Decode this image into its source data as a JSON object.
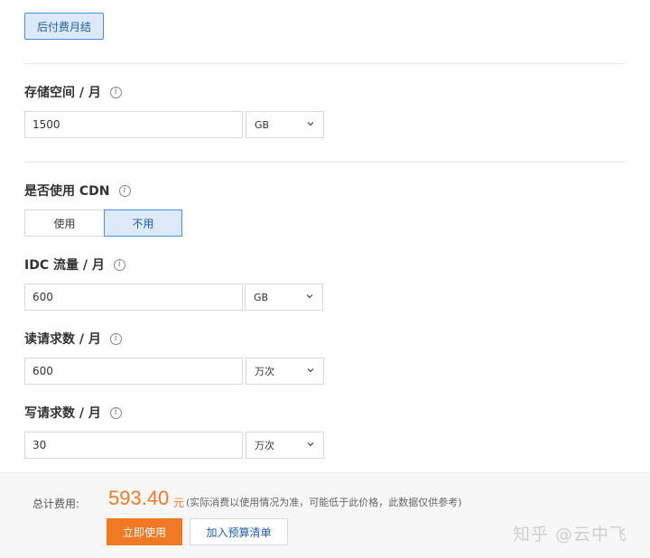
{
  "billing": {
    "mode_label": "后付费月结"
  },
  "storage": {
    "label": "存储空间 / 月",
    "value": "1500",
    "unit": "GB"
  },
  "cdn": {
    "label": "是否使用 CDN",
    "options": [
      "使用",
      "不用"
    ],
    "selected": "不用"
  },
  "idc_traffic": {
    "label": "IDC 流量 / 月",
    "value": "600",
    "unit": "GB"
  },
  "read_requests": {
    "label": "读请求数 / 月",
    "value": "600",
    "unit": "万次"
  },
  "write_requests": {
    "label": "写请求数 / 月",
    "value": "30",
    "unit": "万次"
  },
  "footer": {
    "total_label": "总计费用:",
    "price": "593.40",
    "price_unit": "元",
    "note": "(实际消费以使用情况为准，可能低于此价格，此数据仅供参考)",
    "buy_button": "立即使用",
    "add_button": "加入预算清单"
  },
  "watermark": "知乎 @云中飞",
  "colors": {
    "accent": "#f07a24",
    "selected_bg": "#dbe9f8",
    "selected_border": "#4a90e2"
  }
}
